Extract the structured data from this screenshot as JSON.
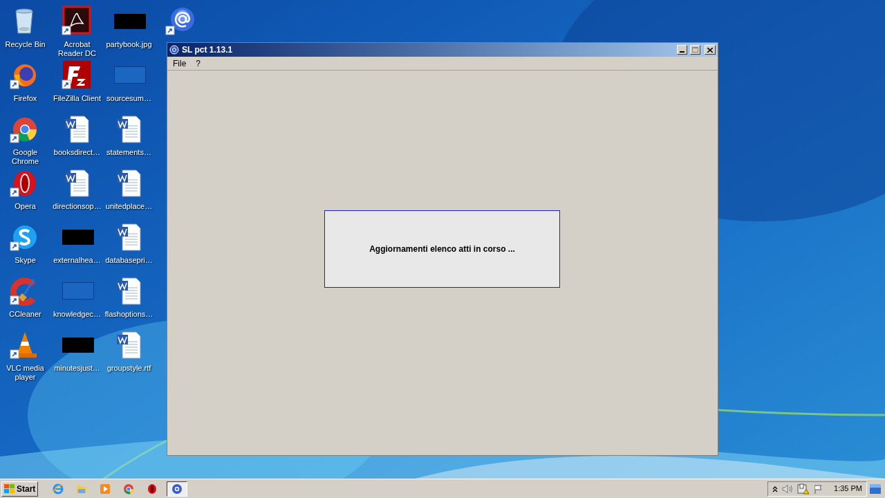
{
  "desktop_icons": [
    {
      "label": "Recycle Bin",
      "kind": "bin",
      "shortcut": false
    },
    {
      "label": "Firefox",
      "kind": "firefox",
      "shortcut": true
    },
    {
      "label": "Google Chrome",
      "kind": "chrome",
      "shortcut": true
    },
    {
      "label": "Opera",
      "kind": "opera",
      "shortcut": true
    },
    {
      "label": "Skype",
      "kind": "skype",
      "shortcut": true
    },
    {
      "label": "CCleaner",
      "kind": "ccleaner",
      "shortcut": true
    },
    {
      "label": "VLC media player",
      "kind": "vlc",
      "shortcut": true
    },
    {
      "label": "Acrobat Reader DC",
      "kind": "pdf",
      "shortcut": true
    },
    {
      "label": "FileZilla Client",
      "kind": "filezilla",
      "shortcut": true
    },
    {
      "label": "booksdirect…",
      "kind": "word",
      "shortcut": false
    },
    {
      "label": "directionsop…",
      "kind": "word",
      "shortcut": false
    },
    {
      "label": "externalhea…",
      "kind": "black",
      "shortcut": false
    },
    {
      "label": "knowledgec…",
      "kind": "blank",
      "shortcut": false
    },
    {
      "label": "minutesjust…",
      "kind": "black",
      "shortcut": false
    },
    {
      "label": "partybook.jpg",
      "kind": "black",
      "shortcut": false
    },
    {
      "label": "sourcesum…",
      "kind": "blank",
      "shortcut": false
    },
    {
      "label": "statements…",
      "kind": "word",
      "shortcut": false
    },
    {
      "label": "unitedplace…",
      "kind": "word",
      "shortcut": false
    },
    {
      "label": "databasepri…",
      "kind": "word",
      "shortcut": false
    },
    {
      "label": "flashoptions…",
      "kind": "word",
      "shortcut": false
    },
    {
      "label": "groupstyle.rtf",
      "kind": "word",
      "shortcut": false
    },
    {
      "kind": "pct",
      "shortcut": true
    }
  ],
  "window": {
    "title": "SL pct 1.13.1",
    "menu": [
      "File",
      "?"
    ],
    "dialog": {
      "message": "Aggiornamenti elenco atti in corso ..."
    }
  },
  "taskbar": {
    "start": "Start",
    "items": [
      {
        "kind": "ie",
        "selected": false
      },
      {
        "kind": "folder",
        "selected": false
      },
      {
        "kind": "media",
        "selected": false
      },
      {
        "kind": "chrome",
        "selected": false
      },
      {
        "kind": "opera",
        "selected": false
      },
      {
        "kind": "pct",
        "selected": true
      }
    ],
    "tray": {
      "time": "1:35 PM"
    }
  }
}
